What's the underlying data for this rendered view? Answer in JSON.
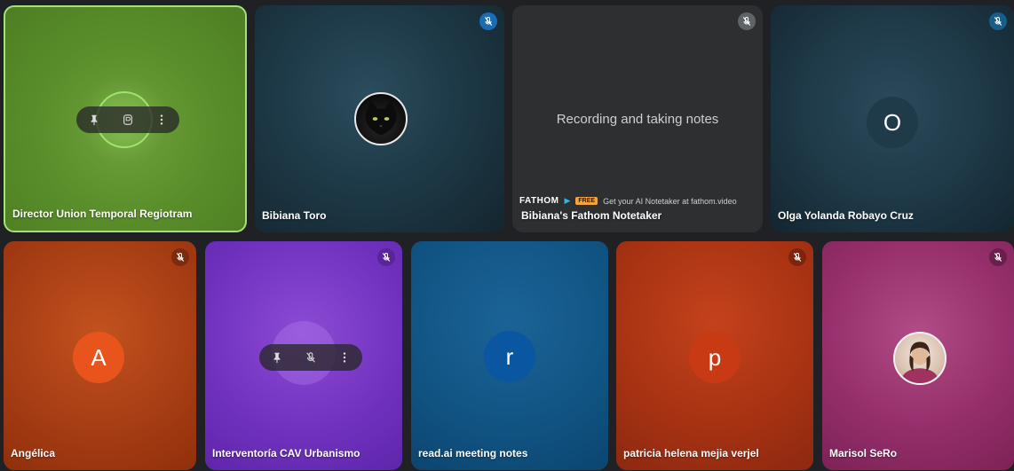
{
  "tiles": [
    {
      "name": "Director Union Temporal Regiotram",
      "type": "speaking",
      "active": true
    },
    {
      "name": "Bibiana Toro",
      "type": "camera-off-photo",
      "muted": true
    },
    {
      "name": "Bibiana's Fathom Notetaker",
      "type": "bot",
      "message": "Recording and taking notes",
      "brand": "FATHOM",
      "badge": "FREE",
      "tagline": "Get your AI Notetaker at fathom.video",
      "muted": true
    },
    {
      "name": "Olga Yolanda Robayo Cruz",
      "type": "letter",
      "letter": "O",
      "muted": true
    },
    {
      "name": "Angélica",
      "type": "letter",
      "letter": "A",
      "muted": true
    },
    {
      "name": "Interventoría CAV Urbanismo",
      "type": "hover-controls",
      "muted": true
    },
    {
      "name": "read.ai meeting notes",
      "type": "letter",
      "letter": "r"
    },
    {
      "name": "patricia helena mejia verjel",
      "type": "letter",
      "letter": "p",
      "muted": true
    },
    {
      "name": "Marisol SeRo",
      "type": "photo",
      "muted": true
    }
  ],
  "colors": {
    "active_border": "#a5e07a",
    "letter_o": "#1f3a49",
    "letter_a": "#e8541c",
    "letter_r": "#0b56a0",
    "letter_p": "#c83a14"
  },
  "icons": {
    "pin": "pin-icon",
    "speaking": "speaking-indicator-icon",
    "more": "more-vert-icon",
    "mic_off": "mic-off-icon"
  }
}
